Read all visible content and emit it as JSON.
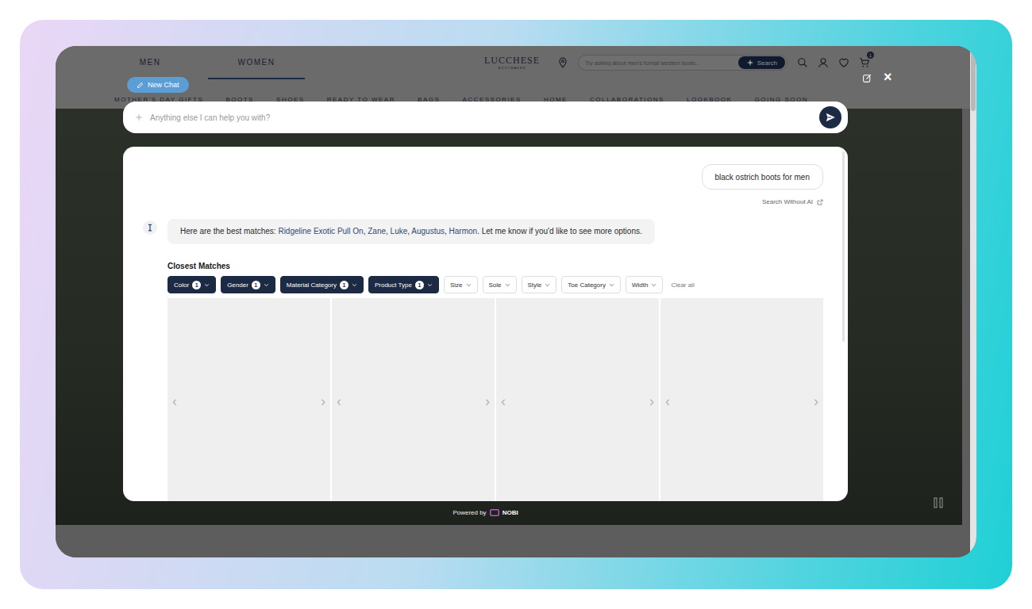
{
  "header": {
    "tabs": [
      {
        "label": "MEN",
        "selected": false
      },
      {
        "label": "WOMEN",
        "selected": true
      }
    ],
    "logo": {
      "name": "LUCCHESE",
      "tagline": "BOOTMAKER"
    },
    "search": {
      "placeholder": "Try asking about men's formal western boots...",
      "button": "Search"
    },
    "cart_count": "1"
  },
  "nav": [
    "MOTHER'S DAY GIFTS",
    "BOOTS",
    "SHOES",
    "READY TO WEAR",
    "BAGS",
    "ACCESSORIES",
    "HOME",
    "COLLABORATIONS",
    "LOOKBOOK",
    "GOING SOON"
  ],
  "chat": {
    "new_chat": "New Chat",
    "close": "×",
    "input_placeholder": "Anything else I can help you with?",
    "user_message": "black ostrich boots for men",
    "search_without_ai": "Search Without AI",
    "reply": {
      "intro": "Here are the best matches: ",
      "links": [
        "Ridgeline Exotic Pull On",
        "Zane",
        "Luke",
        "Augustus",
        "Harmon"
      ],
      "separator": ", ",
      "outro": ". Let me know if you'd like to see more options."
    },
    "section_title": "Closest Matches",
    "filters": [
      {
        "label": "Color",
        "count": "1",
        "selected": true
      },
      {
        "label": "Gender",
        "count": "1",
        "selected": true
      },
      {
        "label": "Material Category",
        "count": "1",
        "selected": true
      },
      {
        "label": "Product Type",
        "count": "1",
        "selected": true
      },
      {
        "label": "Size",
        "count": "",
        "selected": false
      },
      {
        "label": "Sole",
        "count": "",
        "selected": false
      },
      {
        "label": "Style",
        "count": "",
        "selected": false
      },
      {
        "label": "Toe Category",
        "count": "",
        "selected": false
      },
      {
        "label": "Width",
        "count": "",
        "selected": false
      }
    ],
    "clear": "Clear all",
    "products": [
      {
        "prev": "‹",
        "next": "›"
      },
      {
        "prev": "‹",
        "next": "›"
      },
      {
        "prev": "‹",
        "next": "›"
      },
      {
        "prev": "‹",
        "next": "›"
      }
    ]
  },
  "footer": {
    "powered_by": "Powered by",
    "brand": "NOBI"
  }
}
